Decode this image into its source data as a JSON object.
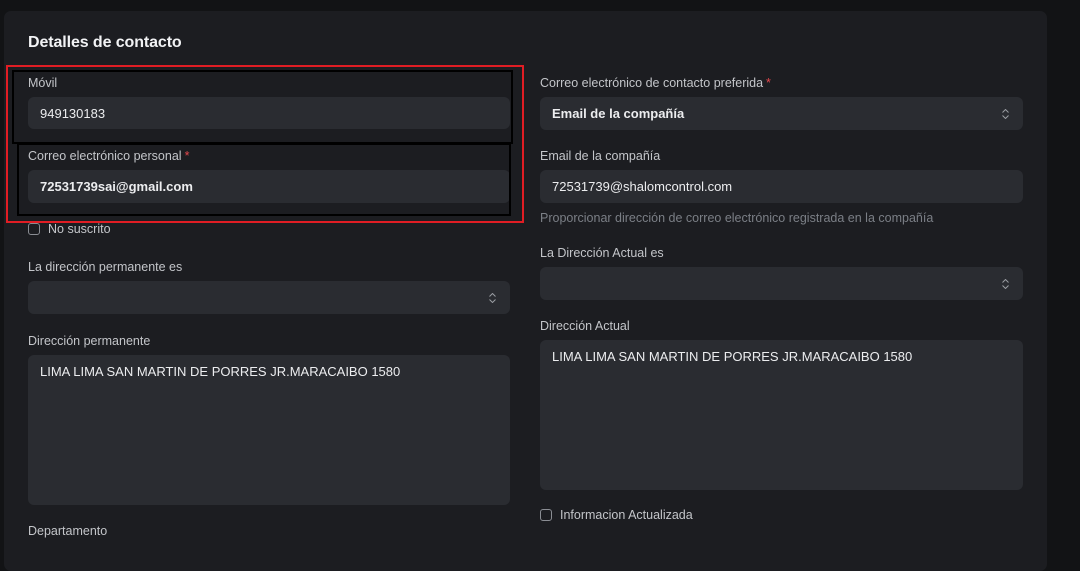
{
  "section": {
    "title": "Detalles de contacto"
  },
  "left": {
    "mobile": {
      "label": "Móvil",
      "value": "949130183"
    },
    "personal_email": {
      "label": "Correo electrónico personal",
      "required": "*",
      "value": "72531739sai@gmail.com"
    },
    "unsubscribed": {
      "label": "No suscrito",
      "checked": false
    },
    "permanent_address_is": {
      "label": "La dirección permanente es",
      "value": ""
    },
    "permanent_address": {
      "label": "Dirección permanente",
      "value": "LIMA LIMA SAN MARTIN DE PORRES JR.MARACAIBO 1580"
    },
    "department": {
      "label": "Departamento"
    }
  },
  "right": {
    "preferred_email": {
      "label": "Correo electrónico de contacto preferida",
      "required": "*",
      "value": "Email de la compañía"
    },
    "company_email": {
      "label": "Email de la compañía",
      "value": "72531739@shalomcontrol.com",
      "help": "Proporcionar dirección de correo electrónico registrada en la compañía"
    },
    "current_address_is": {
      "label": "La Dirección Actual es",
      "value": ""
    },
    "current_address": {
      "label": "Dirección Actual",
      "value": "LIMA LIMA SAN MARTIN DE PORRES JR.MARACAIBO 1580"
    },
    "info_updated": {
      "label": "Informacion Actualizada",
      "checked": false
    }
  },
  "icons": {
    "select": "chevron-up-down-icon"
  },
  "colors": {
    "required": "#e5484d",
    "highlight": "#e11d24"
  }
}
